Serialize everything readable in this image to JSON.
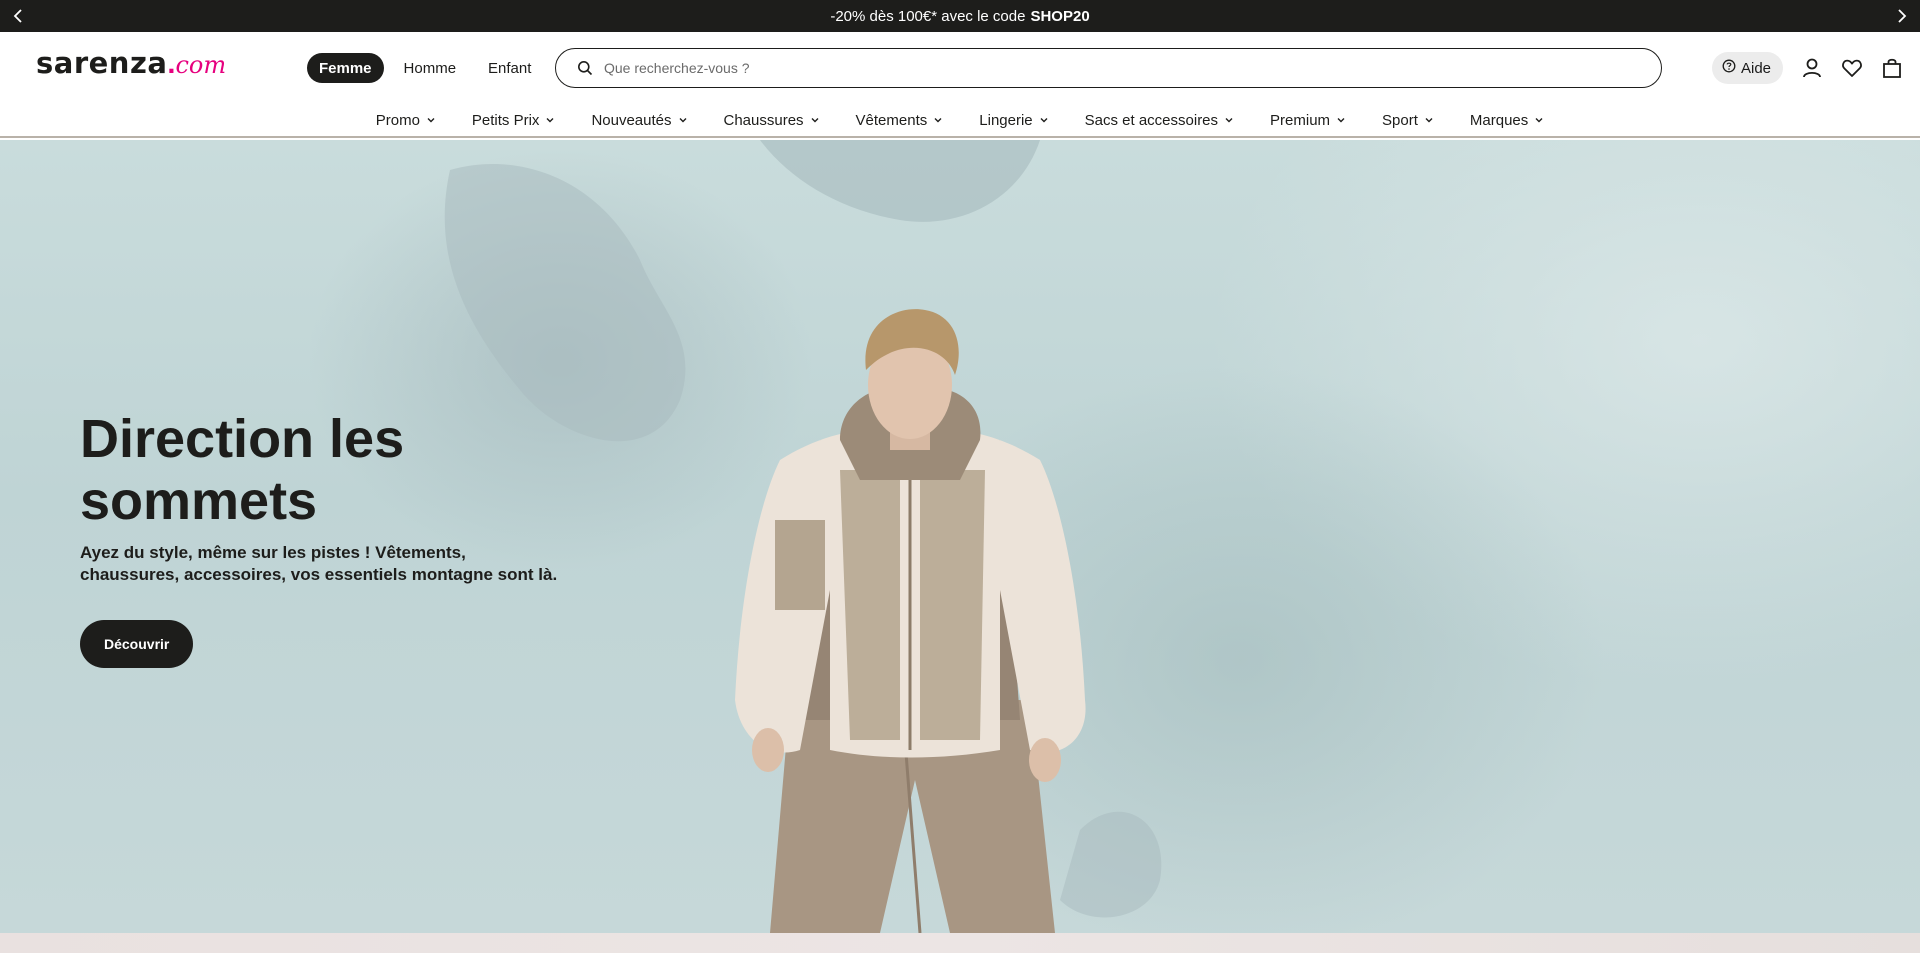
{
  "promo": {
    "text": "-20% dès 100€* avec le code",
    "code": "SHOP20"
  },
  "logo": {
    "brand": "sarenza",
    "dot": ".",
    "tld": "com"
  },
  "gender_tabs": [
    {
      "label": "Femme",
      "active": true
    },
    {
      "label": "Homme",
      "active": false
    },
    {
      "label": "Enfant",
      "active": false
    }
  ],
  "search": {
    "placeholder": "Que recherchez-vous ?"
  },
  "help": {
    "label": "Aide"
  },
  "nav": {
    "items": [
      {
        "label": "Promo"
      },
      {
        "label": "Petits Prix"
      },
      {
        "label": "Nouveautés"
      },
      {
        "label": "Chaussures"
      },
      {
        "label": "Vêtements"
      },
      {
        "label": "Lingerie"
      },
      {
        "label": "Sacs et accessoires"
      },
      {
        "label": "Premium"
      },
      {
        "label": "Sport"
      },
      {
        "label": "Marques"
      }
    ]
  },
  "hero": {
    "title_line1": "Direction les",
    "title_line2": "sommets",
    "subtitle": "Ayez du style, même sur les pistes ! Vêtements, chaussures, accessoires, vos essentiels montagne sont là.",
    "cta": "Découvrir"
  },
  "colors": {
    "dark": "#1d1d1b",
    "accent": "#e6007e",
    "hero_bg": "#c6d9da"
  }
}
